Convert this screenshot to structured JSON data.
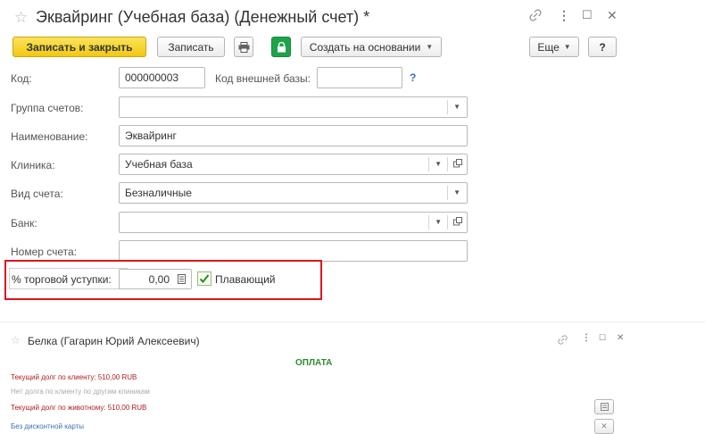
{
  "window": {
    "title": "Эквайринг (Учебная база) (Денежный счет) *",
    "star_icon": "☆",
    "link_icon": "🔗",
    "menu_icon": "⋮",
    "maximize_icon": "☐",
    "close_icon": "✕"
  },
  "toolbar": {
    "save_close": "Записать и закрыть",
    "save": "Записать",
    "create_based": "Создать на основании",
    "more": "Еще",
    "help": "?"
  },
  "form": {
    "code_label": "Код:",
    "code_value": "000000003",
    "ext_code_label": "Код внешней базы:",
    "ext_code_value": "",
    "ext_help": "?",
    "group_label": "Группа счетов:",
    "group_value": "",
    "name_label": "Наименование:",
    "name_value": "Эквайринг",
    "clinic_label": "Клиника:",
    "clinic_value": "Учебная база",
    "type_label": "Вид счета:",
    "type_value": "Безналичные",
    "bank_label": "Банк:",
    "bank_value": "",
    "account_label": "Номер счета:",
    "account_value": "",
    "discount_label": "% торговой уступки:",
    "discount_value": "0,00",
    "floating_label": "Плавающий",
    "floating_checked": true
  },
  "second_window": {
    "title": "Белка (Гагарин Юрий Алексеевич)",
    "payment_heading": "ОПЛАТА",
    "line1": "Текущий долг по клиенту: 510,00 RUB",
    "line2": "Нет долга по клиенту по другим клиникам",
    "line3": "Текущий долг по животному: 510,00 RUB",
    "line4": "Без дисконтной карты"
  },
  "colors": {
    "accent_yellow": "#f2c811",
    "highlight_red": "#e0141c",
    "payment_green": "#2e8b2e",
    "debt_red": "#b02020",
    "link_blue": "#3a6fb7"
  }
}
